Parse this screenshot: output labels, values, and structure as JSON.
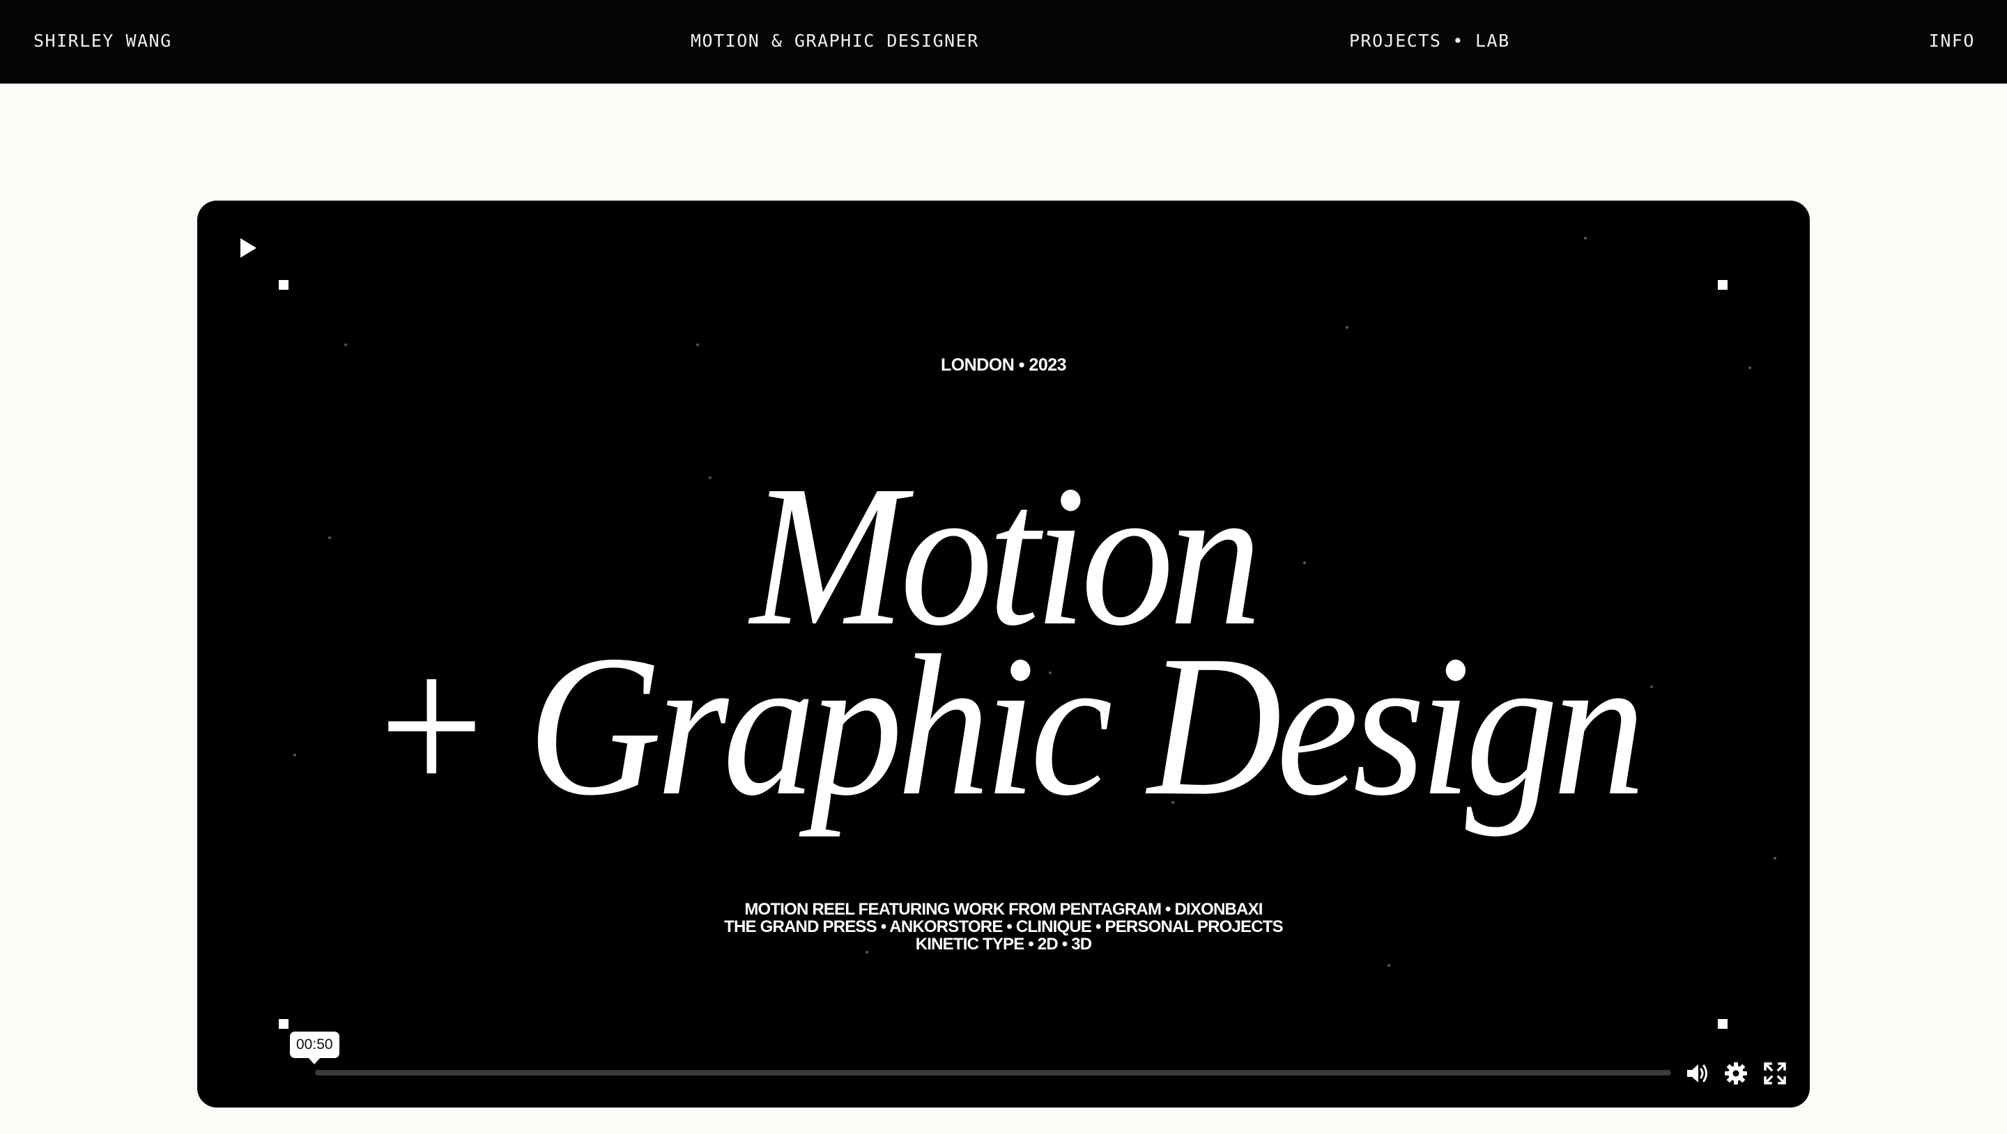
{
  "header": {
    "name": "SHIRLEY WANG",
    "role": "MOTION & GRAPHIC DESIGNER",
    "projects_label": "PROJECTS",
    "separator": "•",
    "lab_label": "LAB",
    "info_label": "INFO"
  },
  "video": {
    "kicker": "LONDON  • 2023",
    "headline_line1": "Motion",
    "headline_line2": "+ Graphic Design",
    "credits": [
      "MOTION REEL FEATURING WORK FROM PENTAGRAM • DIXONBAXI",
      "THE GRAND PRESS • ANKORSTORE • CLINIQUE • PERSONAL PROJECTS",
      "KINETIC TYPE • 2D • 3D"
    ],
    "hover_time": "00:50",
    "progress_fraction": 0.0
  },
  "icons": {
    "play": "play-icon",
    "volume": "volume-icon",
    "settings": "gear-icon",
    "fullscreen": "fullscreen-icon"
  },
  "colors": {
    "page_background": "#fcfbf7",
    "topbar_background": "#050505",
    "player_background": "#000000",
    "text_on_dark": "#ffffff"
  }
}
